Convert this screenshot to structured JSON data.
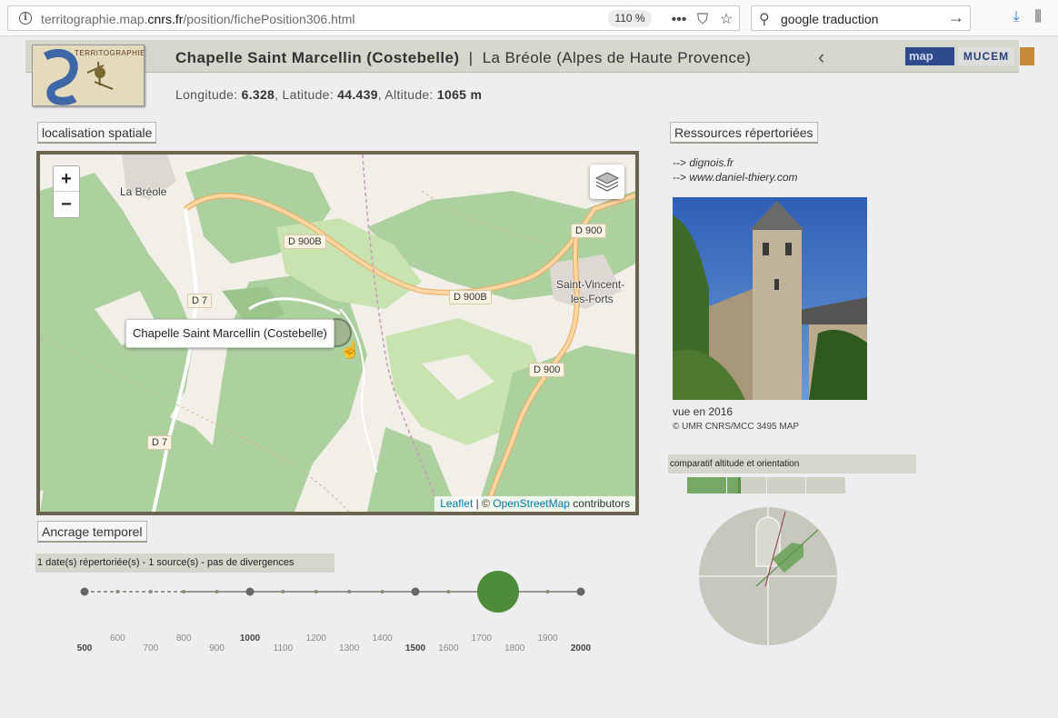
{
  "browser": {
    "url_prefix": "territographie.map.",
    "url_domain": "cnrs.fr",
    "url_path": "/position/fichePosition306.html",
    "zoom": "110 %",
    "search_value": "google traduction"
  },
  "header": {
    "logo_text": "TERRITOGRAPHIE",
    "title_main": "Chapelle Saint Marcellin (Costebelle)",
    "title_sep": "|",
    "title_place": "La Bréole (Alpes de Haute Provence)",
    "partner_map": "map",
    "partner_mucem": "MUCEM"
  },
  "coords": {
    "lon_label": "Longitude:",
    "lon": "6.328",
    "lat_label": "Latitude:",
    "lat": "44.439",
    "alt_label": "Altitude:",
    "alt": "1065 m"
  },
  "sections": {
    "spatial": "localisation spatiale",
    "temporal": "Ancrage temporel",
    "resources": "Ressources répertoriées"
  },
  "map": {
    "zoom_in": "+",
    "zoom_out": "−",
    "places": [
      "La Bréole",
      "Saint-Vincent-",
      "les-Forts"
    ],
    "roads": [
      "D 900B",
      "D 900",
      "D 7",
      "D 900B",
      "D 900",
      "D 7"
    ],
    "tooltip": "Chapelle Saint Marcellin (Costebelle)",
    "attr_leaflet": "Leaflet",
    "attr_sep": " | © ",
    "attr_osm": "OpenStreetMap",
    "attr_tail": " contributors"
  },
  "timeline": {
    "summary": "1 date(s) répertoriée(s) - 1 source(s) - pas de divergences",
    "ticks_major": [
      "500",
      "1000",
      "1500",
      "2000"
    ],
    "ticks_upper": [
      "600",
      "800",
      "1200",
      "1400",
      "1700",
      "1900"
    ],
    "ticks_lower": [
      "700",
      "900",
      "1100",
      "1300",
      "1600",
      "1800"
    ],
    "event_year": 1750,
    "event_color": "#4f8c3a"
  },
  "resources": {
    "links": [
      "dignois.fr",
      "www.daniel-thiery.com"
    ],
    "link_prefix": "--> ",
    "caption": "vue en 2016",
    "copyright": "©  UMR CNRS/MCC 3495 MAP"
  },
  "comparison": {
    "label": "comparatif altitude et orientation",
    "altitude_fraction": 0.34
  }
}
